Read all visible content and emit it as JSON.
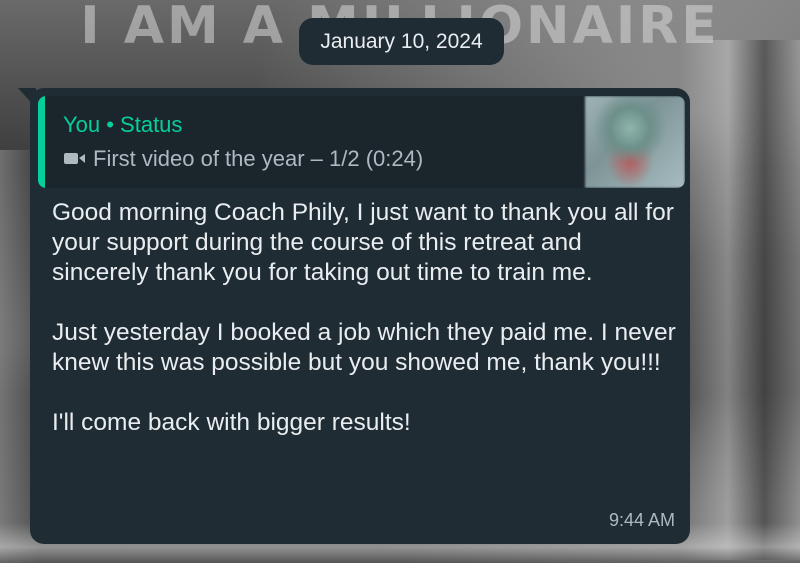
{
  "background": {
    "banner_text": "I AM A MILLIONAIRE"
  },
  "date_separator": "January 10, 2024",
  "message": {
    "quoted": {
      "author": "You • Status",
      "media_label": "First video of the year – 1/2 (0:24)",
      "media_icon": "video-camera-icon"
    },
    "text": "Good morning Coach Phily, I just want to thank you all for your support during the course of this retreat and sincerely thank you for taking out time to train me.\n\nJust yesterday I booked a job which they paid me. I never knew this was possible but you showed me, thank you!!!\n\nI'll come back with bigger results!",
    "time": "9:44 AM"
  },
  "colors": {
    "bubble": "#1f2c34",
    "accent": "#06cf9c",
    "text": "#e9edef",
    "secondary": "#aeb9c0"
  }
}
